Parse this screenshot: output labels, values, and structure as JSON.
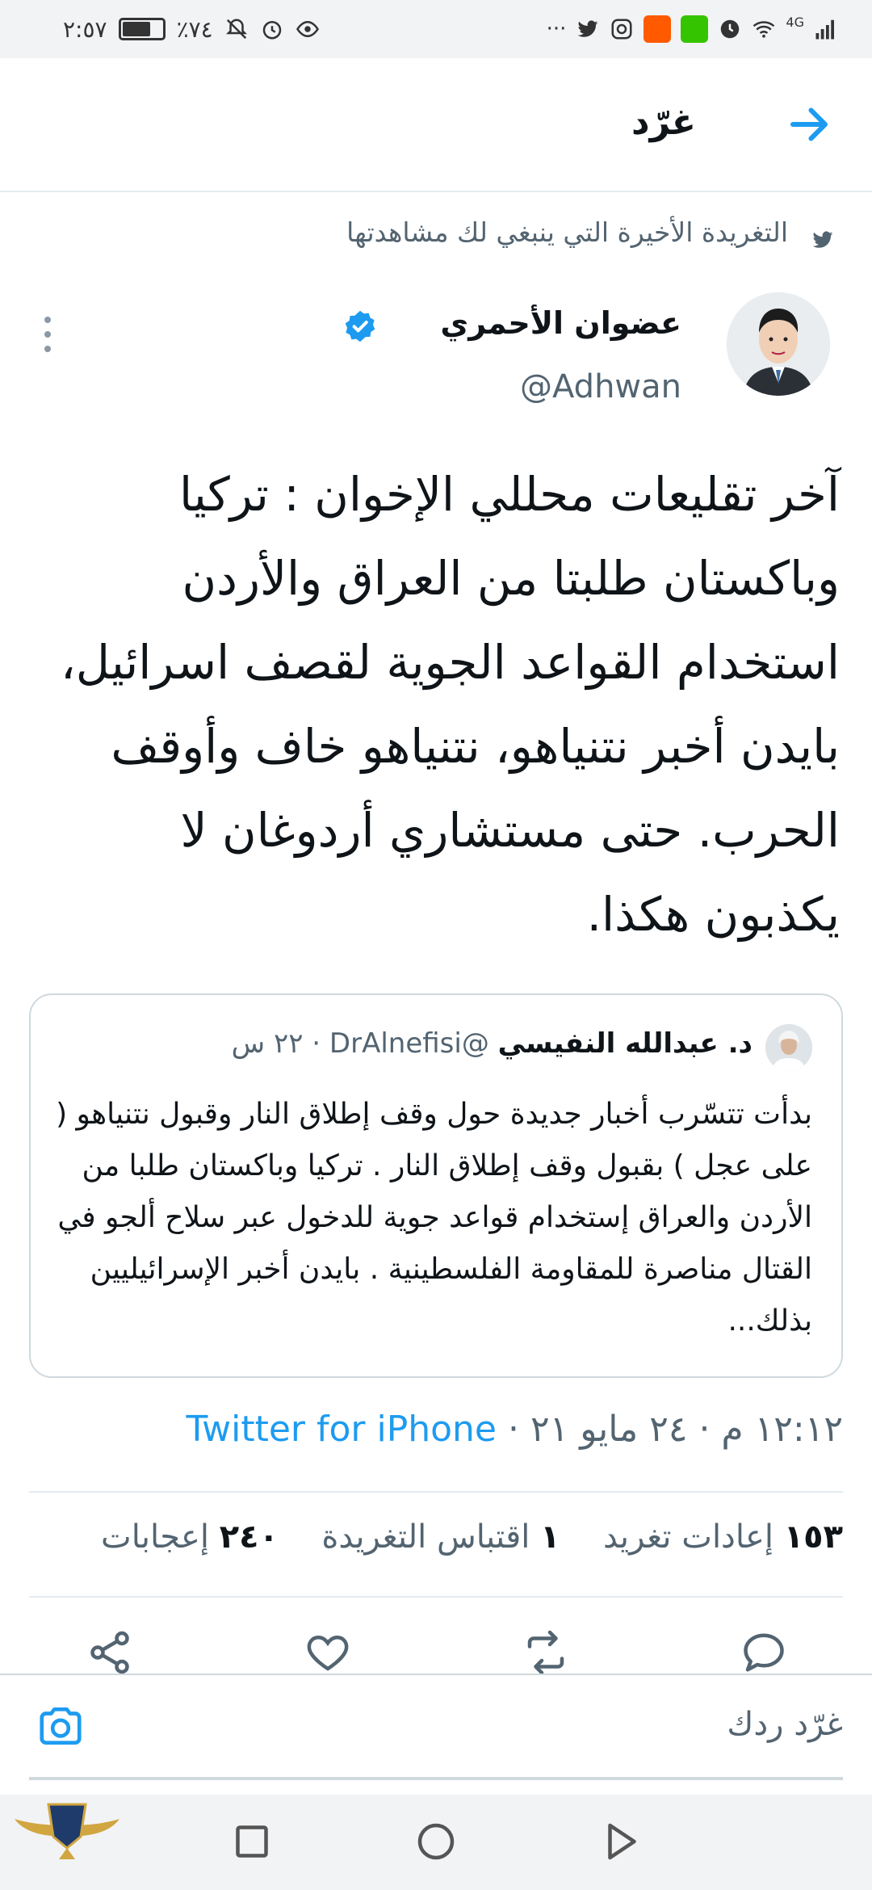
{
  "status_bar": {
    "time": "٢:٥٧",
    "battery": "٪٧٤",
    "battery_level": 0.74,
    "network": "4G"
  },
  "header": {
    "title": "غرّد"
  },
  "recommendation": "التغريدة الأخيرة التي ينبغي لك مشاهدتها",
  "tweet": {
    "author_name": "عضوان الأحمري",
    "handle": "@Adhwan",
    "text": "آخر تقليعات محللي الإخوان : تركيا وباكستان طلبتا من العراق والأردن استخدام القواعد الجوية لقصف اسرائيل، بايدن أخبر نتنياهو، نتنياهو خاف وأوقف الحرب. حتى مستشاري أردوغان لا يكذبون هكذا."
  },
  "quoted_tweet": {
    "name": "د. عبدالله النفيسي",
    "handle": "@DrAlnefisi",
    "time": "· ٢٢ س",
    "text": "بدأت تتسّرب أخبار جديدة حول وقف إطلاق النار وقبول نتنياهو ( على عجل ) بقبول وقف إطلاق النار . تركيا وباكستان طلبا من الأردن والعراق إستخدام قواعد جوية للدخول عبر سلاح ألجو في القتال مناصرة للمقاومة الفلسطينية . بايدن أخبر الإسرائيليين بذلك..."
  },
  "meta": {
    "timestamp": "١٢:١٢ م · ٢٤ مايو ٢١ ·",
    "source": "Twitter for iPhone"
  },
  "stats": {
    "retweets_count": "١٥٣",
    "retweets_label": "إعادات تغريد",
    "quotes_count": "١",
    "quotes_label": "اقتباس التغريدة",
    "likes_count": "٢٤٠",
    "likes_label": "إعجابات"
  },
  "reply_bar": {
    "placeholder": "غرّد ردك"
  },
  "icons": [
    "back-arrow-icon",
    "twitter-bird-icon",
    "verified-badge-icon",
    "more-vertical-icon",
    "reply-icon",
    "retweet-icon",
    "like-icon",
    "share-icon",
    "camera-icon",
    "nav-back-icon",
    "nav-home-icon",
    "nav-recents-icon"
  ],
  "colors": {
    "accent": "#1d9bf0",
    "secondary_text": "#536471",
    "primary_text": "#0f1419"
  }
}
